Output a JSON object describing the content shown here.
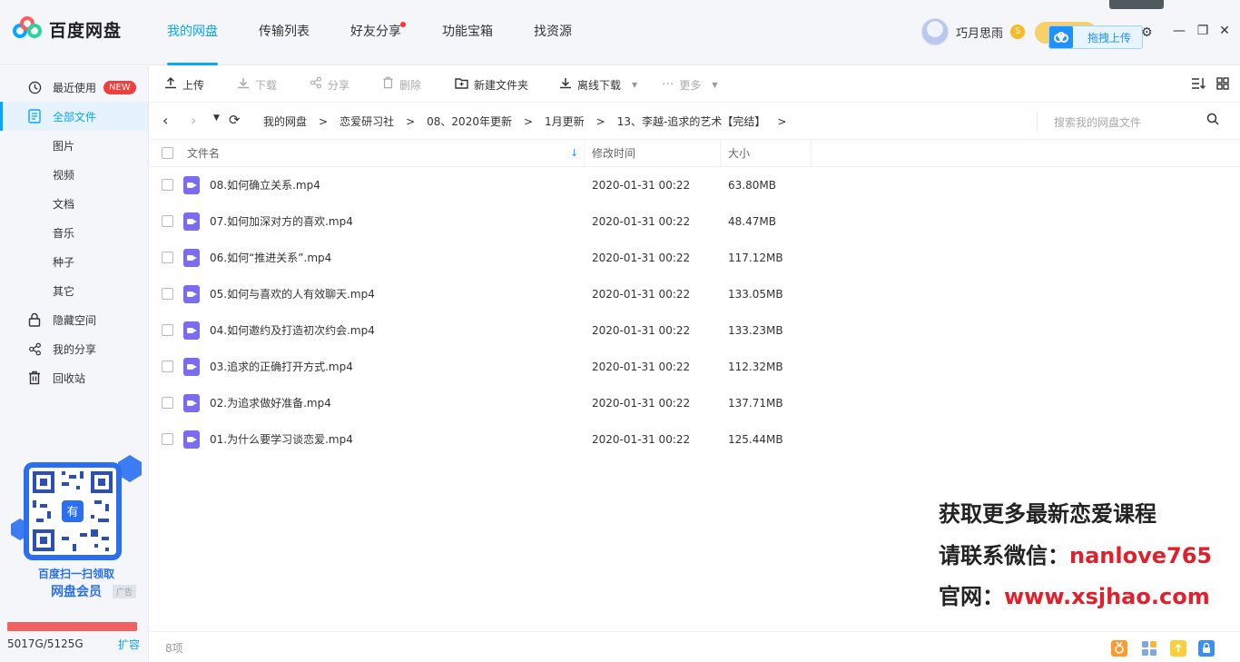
{
  "header": {
    "app_name": "百度网盘",
    "nav": [
      {
        "label": "我的网盘",
        "active": true
      },
      {
        "label": "传输列表"
      },
      {
        "label": "好友分享",
        "dot": true
      },
      {
        "label": "功能宝箱"
      },
      {
        "label": "找资源"
      }
    ],
    "username": "巧月思雨",
    "vip_icon": "S",
    "drag_upload_label": "拖拽上传",
    "window_controls": [
      "settings-icon",
      "minimize-icon",
      "restore-icon",
      "close-icon"
    ]
  },
  "sidebar": {
    "recent": {
      "label": "最近使用",
      "badge": "NEW"
    },
    "all_files": "全部文件",
    "categories": [
      "图片",
      "视频",
      "文档",
      "音乐",
      "种子",
      "其它"
    ],
    "hidden_space": "隐藏空间",
    "my_share": "我的分享",
    "recycle": "回收站",
    "promo": {
      "line1": "百度扫一扫领取",
      "line2": "网盘会员",
      "ad": "广告",
      "qr_center": "有"
    },
    "storage": {
      "text": "5017G/5125G",
      "expand": "扩容",
      "used_fraction": 0.979
    }
  },
  "toolbar": {
    "upload": "上传",
    "download": "下载",
    "share": "分享",
    "delete": "删除",
    "new_folder": "新建文件夹",
    "offline_download": "离线下载",
    "more": "更多"
  },
  "breadcrumb": {
    "items": [
      "我的网盘",
      "恋爱研习社",
      "08、2020年更新",
      "1月更新",
      "13、李越-追求的艺术【完结】"
    ],
    "search_placeholder": "搜索我的网盘文件"
  },
  "table": {
    "headers": {
      "name": "文件名",
      "modified": "修改时间",
      "size": "大小"
    },
    "rows": [
      {
        "name": "08.如何确立关系.mp4",
        "modified": "2020-01-31 00:22",
        "size": "63.80MB"
      },
      {
        "name": "07.如何加深对方的喜欢.mp4",
        "modified": "2020-01-31 00:22",
        "size": "48.47MB"
      },
      {
        "name": "06.如何“推进关系”.mp4",
        "modified": "2020-01-31 00:22",
        "size": "117.12MB"
      },
      {
        "name": "05.如何与喜欢的人有效聊天.mp4",
        "modified": "2020-01-31 00:22",
        "size": "133.05MB"
      },
      {
        "name": "04.如何邀约及打造初次约会.mp4",
        "modified": "2020-01-31 00:22",
        "size": "133.23MB"
      },
      {
        "name": "03.追求的正确打开方式.mp4",
        "modified": "2020-01-31 00:22",
        "size": "112.32MB"
      },
      {
        "name": "02.为追求做好准备.mp4",
        "modified": "2020-01-31 00:22",
        "size": "137.71MB"
      },
      {
        "name": "01.为什么要学习谈恋爱.mp4",
        "modified": "2020-01-31 00:22",
        "size": "125.44MB"
      }
    ]
  },
  "watermark": {
    "line1": "获取更多最新恋爱课程",
    "line2_prefix": "请联系微信：",
    "line2_value": "nanlove765",
    "line3_prefix": "官网：",
    "line3_value": "www.xsjhao.com"
  },
  "footer": {
    "count": "8项"
  },
  "colors": {
    "accent": "#06a7ff",
    "video_icon": "#7a6cf2",
    "storage_bar": "#f06363",
    "watermark_red": "#e0212c"
  }
}
